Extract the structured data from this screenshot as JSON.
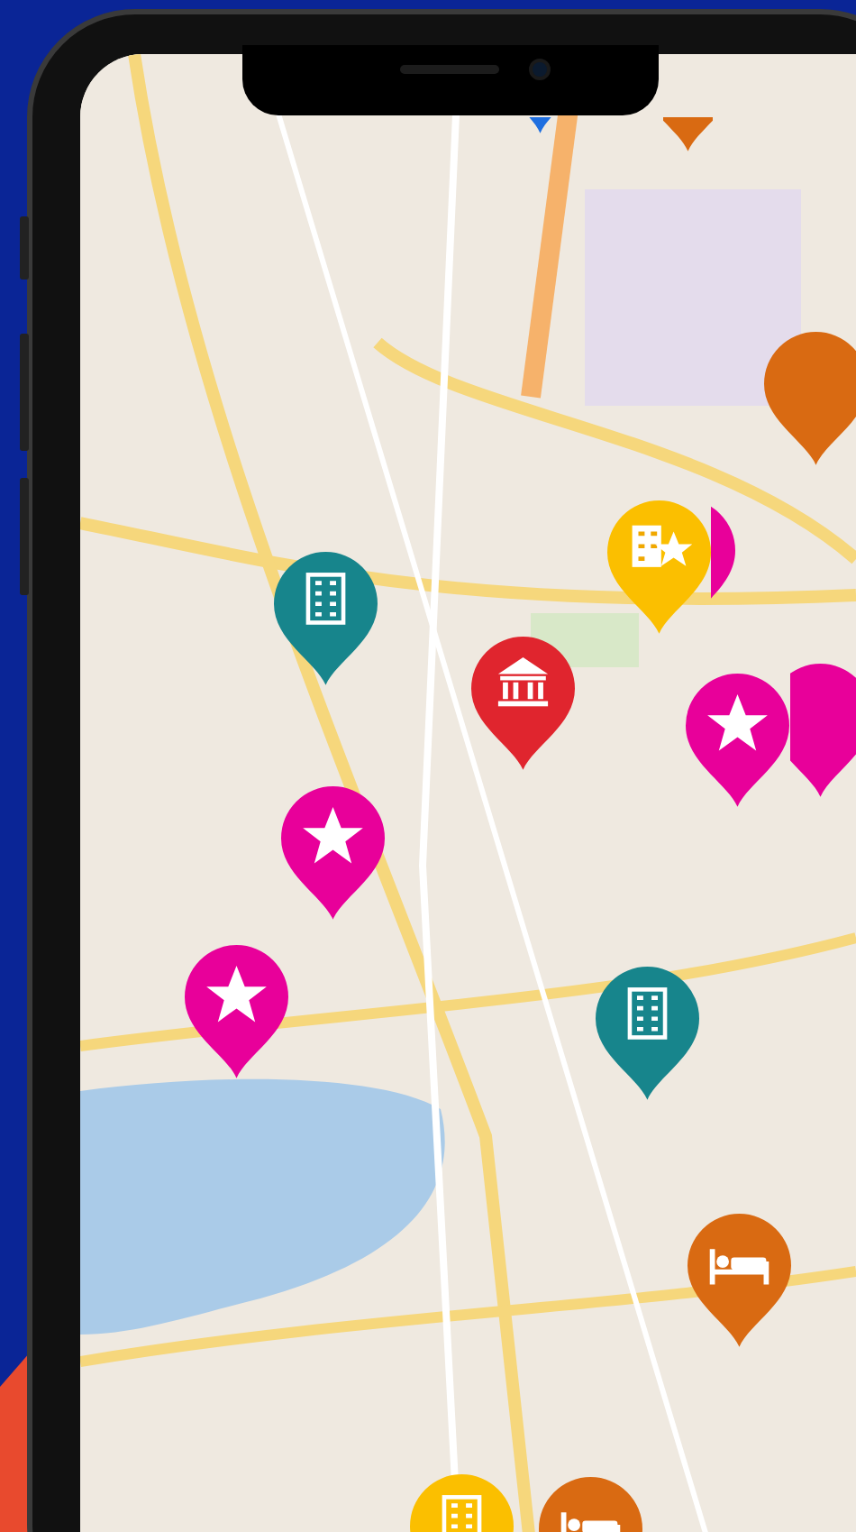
{
  "pins": [
    {
      "kind": "building",
      "color": "#17858c"
    },
    {
      "kind": "plain",
      "color": "#e8009a"
    },
    {
      "kind": "building-star",
      "color": "#fbbf00"
    },
    {
      "kind": "museum",
      "color": "#e0252e"
    },
    {
      "kind": "star",
      "color": "#e8009a"
    },
    {
      "kind": "plain",
      "color": "#e8009a"
    },
    {
      "kind": "star",
      "color": "#e8009a"
    },
    {
      "kind": "star",
      "color": "#e8009a"
    },
    {
      "kind": "building",
      "color": "#17858c"
    },
    {
      "kind": "bed",
      "color": "#d96a12"
    },
    {
      "kind": "plain",
      "color": "#d96a12"
    },
    {
      "kind": "plain",
      "color": "#d96a12"
    },
    {
      "kind": "plain",
      "color": "#1f6fe0"
    },
    {
      "kind": "building",
      "color": "#fbbf00"
    },
    {
      "kind": "bed",
      "color": "#d96a12"
    }
  ]
}
